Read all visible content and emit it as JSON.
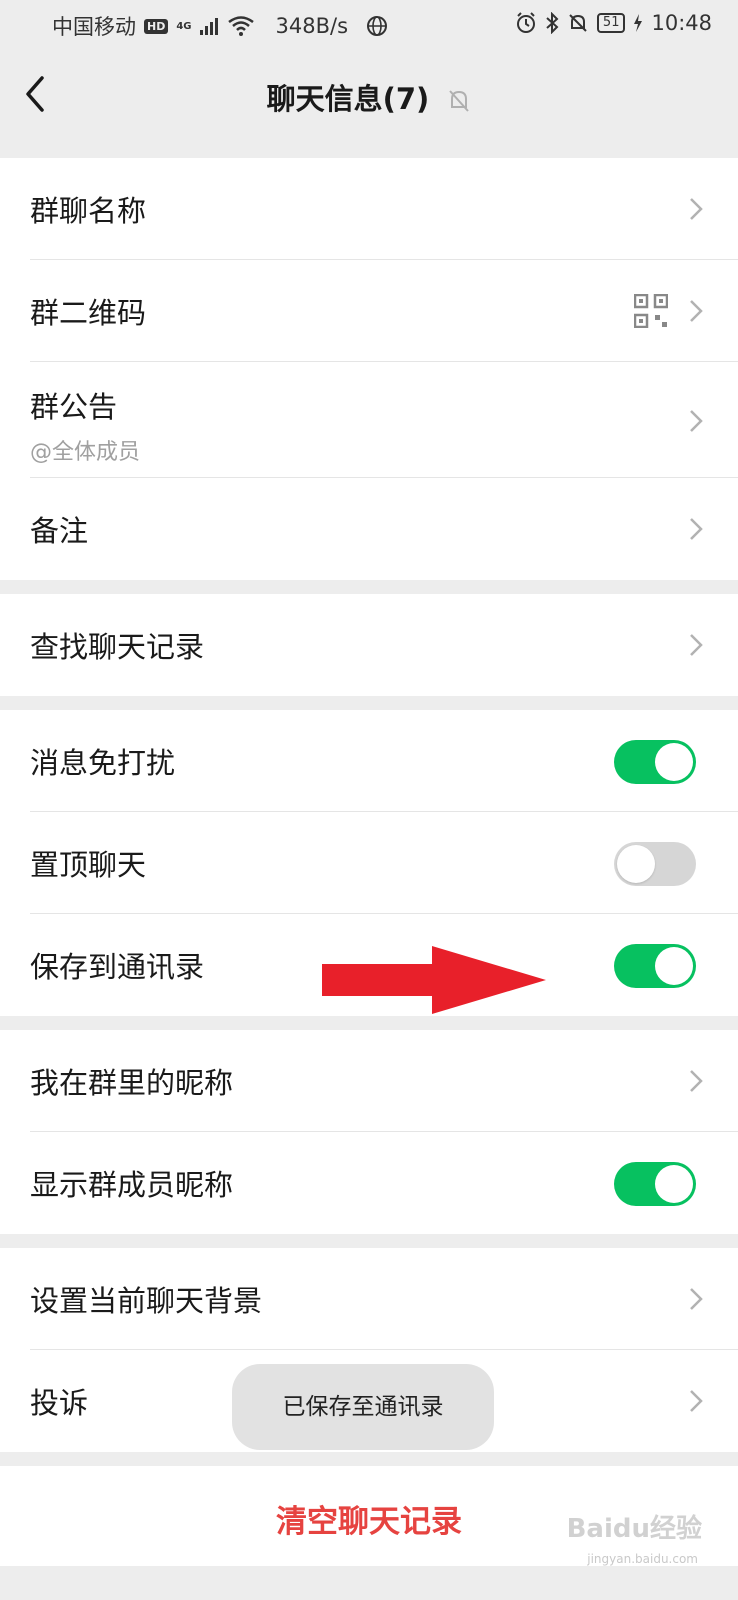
{
  "status_bar": {
    "carrier": "中国移动",
    "hd": "HD",
    "network": "4G",
    "speed": "348B/s",
    "battery": "51",
    "time": "10:48"
  },
  "nav": {
    "title": "聊天信息(7)"
  },
  "group1": {
    "group_name_label": "群聊名称",
    "qr_label": "群二维码",
    "notice_label": "群公告",
    "notice_sub": "@全体成员",
    "remark_label": "备注"
  },
  "group2": {
    "search_label": "查找聊天记录"
  },
  "group3": {
    "dnd_label": "消息免打扰",
    "dnd_on": true,
    "pin_label": "置顶聊天",
    "pin_on": false,
    "save_label": "保存到通讯录",
    "save_on": true
  },
  "group4": {
    "nickname_label": "我在群里的昵称",
    "show_nick_label": "显示群成员昵称",
    "show_nick_on": true
  },
  "group5": {
    "bg_label": "设置当前聊天背景",
    "complain_label": "投诉"
  },
  "clear_label": "清空聊天记录",
  "toast": "已保存至通讯录",
  "watermark": "Baidu经验",
  "watermark_sub": "jingyan.baidu.com",
  "colors": {
    "toggle_on": "#07c160",
    "danger": "#e64340",
    "annotation_arrow": "#e8202a"
  }
}
